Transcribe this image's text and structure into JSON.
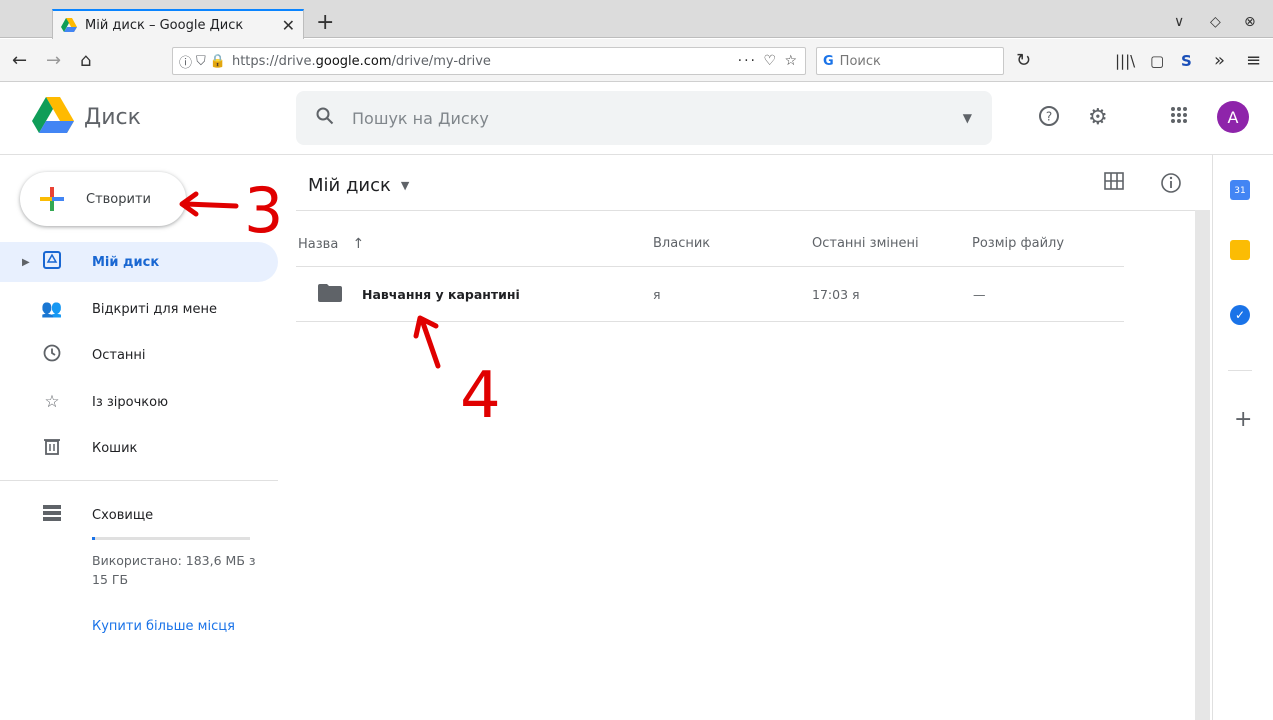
{
  "browser": {
    "tab_title": "Мій диск – Google Диск",
    "url_prefix": "https://drive.",
    "url_host": "google.com",
    "url_path": "/drive/my-drive",
    "search_placeholder": "Поиск"
  },
  "drive": {
    "app_title": "Диск",
    "search_placeholder": "Пошук на Диску",
    "avatar_letter": "A"
  },
  "sidebar": {
    "create_label": "Створити",
    "items": [
      {
        "label": "Мій диск"
      },
      {
        "label": "Відкриті для мене"
      },
      {
        "label": "Останні"
      },
      {
        "label": "Із зірочкою"
      },
      {
        "label": "Кошик"
      }
    ],
    "storage_label": "Сховище",
    "storage_used_text": "Використано: 183,6 МБ з 15 ГБ",
    "storage_used_fraction": 0.012,
    "buy_more": "Купити більше місця"
  },
  "main": {
    "title": "Мій диск",
    "columns": [
      "Назва",
      "Власник",
      "Останні змінені",
      "Розмір файлу"
    ],
    "rows": [
      {
        "name": "Навчання у карантині",
        "owner": "я",
        "modified": "17:03 я",
        "size": "—"
      }
    ]
  },
  "annotations": {
    "step3": "3",
    "step4": "4"
  },
  "colors": {
    "accent": "#1a73e8",
    "active_bg": "#e8f0fe",
    "avatar": "#8e24aa",
    "annotation": "#e00000"
  }
}
